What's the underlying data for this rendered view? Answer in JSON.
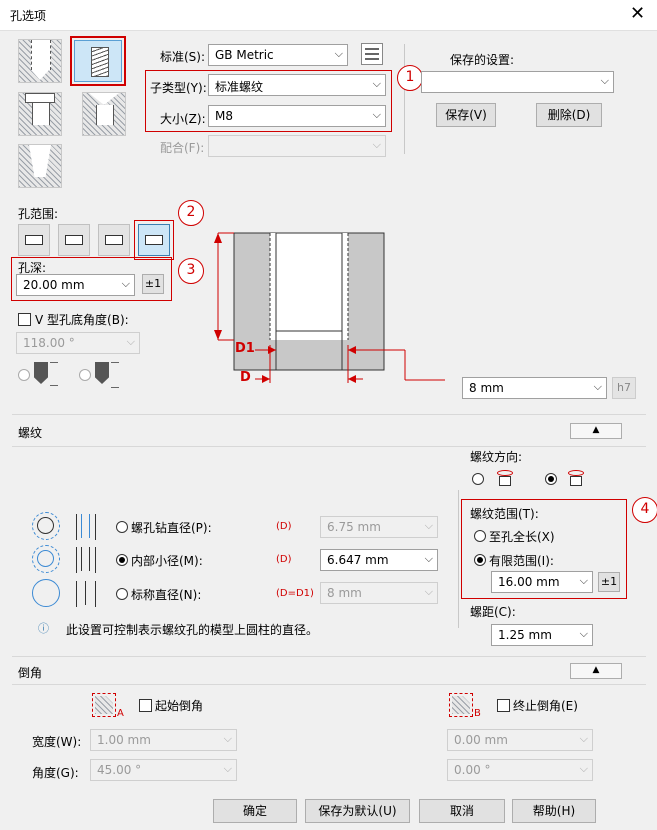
{
  "window": {
    "title": "孔选项",
    "close": "✕"
  },
  "type": {
    "standard_label": "标准(S):",
    "standard_value": "GB Metric",
    "subtype_label": "子类型(Y):",
    "subtype_value": "标准螺纹",
    "size_label": "大小(Z):",
    "size_value": "M8",
    "fit_label": "配合(F):",
    "fit_value": ""
  },
  "saved": {
    "label": "保存的设置:",
    "value": "",
    "save": "保存(V)",
    "delete": "删除(D)"
  },
  "callouts": [
    "1",
    "2",
    "3",
    "4"
  ],
  "range": {
    "label": "孔范围:"
  },
  "depth": {
    "label": "孔深:",
    "value": "20.00 mm",
    "tol": "±1"
  },
  "vangle": {
    "label": "V 型孔底角度(B):",
    "value": "118.00 °"
  },
  "diagram": {
    "d1": "D1",
    "d": "D",
    "d_value": "8 mm",
    "fit_badge": "h7"
  },
  "thread": {
    "title": "螺纹",
    "direction_label": "螺纹方向:",
    "tap_label": "螺孔钻直径(P):",
    "tap_sym": "(D)",
    "tap_value": "6.75 mm",
    "minor_label": "内部小径(M):",
    "minor_sym": "(D)",
    "minor_value": "6.647 mm",
    "nominal_label": "标称直径(N):",
    "nominal_sym": "(D=D1)",
    "nominal_value": "8 mm",
    "info": "此设置可控制表示螺纹孔的模型上圆柱的直径。",
    "range_label": "螺纹范围(T):",
    "full": "至孔全长(X)",
    "limited": "有限范围(I):",
    "range_value": "16.00 mm",
    "range_tol": "±1",
    "pitch_label": "螺距(C):",
    "pitch_value": "1.25 mm"
  },
  "chamfer": {
    "title": "倒角",
    "start_label": "起始倒角",
    "end_label": "终止倒角(E)",
    "tag_a": "A",
    "tag_b": "B",
    "width_label": "宽度(W):",
    "width_a": "1.00 mm",
    "width_b": "0.00 mm",
    "angle_label": "角度(G):",
    "angle_a": "45.00 °",
    "angle_b": "0.00 °"
  },
  "footer": {
    "ok": "确定",
    "save_default": "保存为默认(U)",
    "cancel": "取消",
    "help": "帮助(H)"
  },
  "colors": {
    "accent_red": "#d00000",
    "selected_blue": "#cde6f7"
  }
}
